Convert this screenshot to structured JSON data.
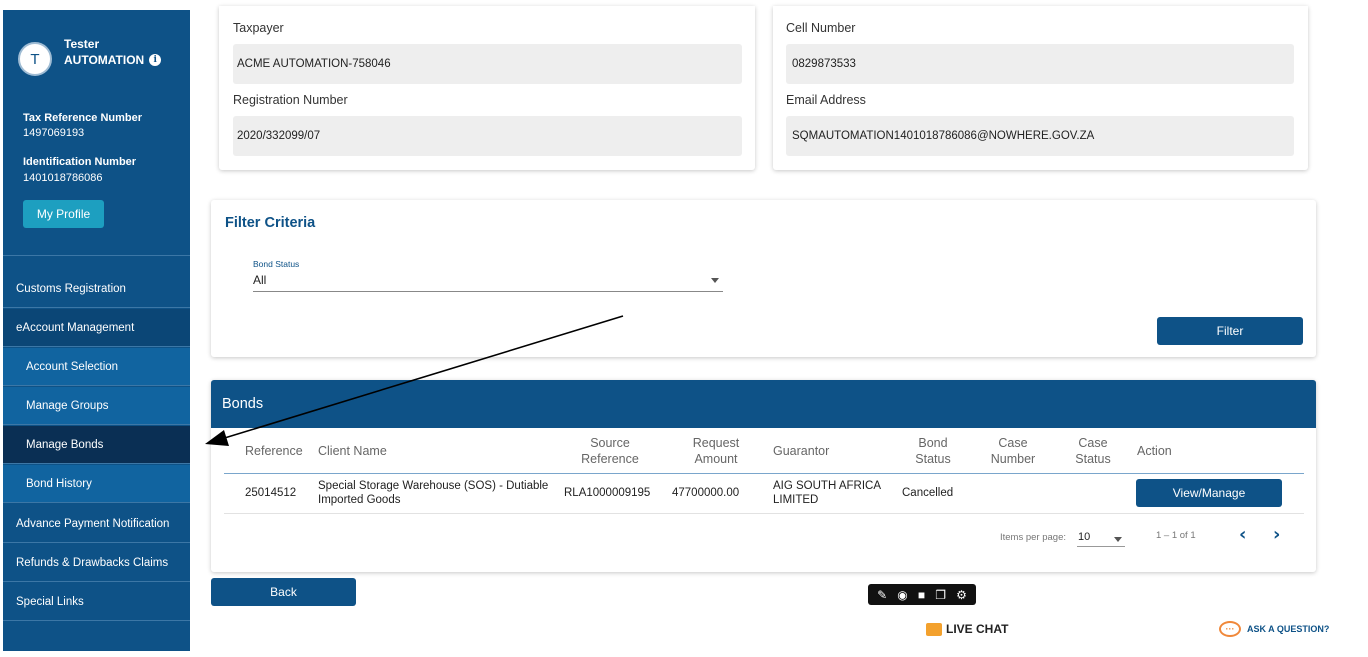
{
  "user": {
    "initial": "T",
    "first_name": "Tester",
    "last_name": "AUTOMATION",
    "tax_ref_label": "Tax Reference Number",
    "tax_ref_value": "1497069193",
    "id_label": "Identification Number",
    "id_value": "1401018786086",
    "profile_button": "My Profile"
  },
  "sidebar": {
    "items": [
      {
        "label": "Customs Registration"
      },
      {
        "label": "eAccount Management"
      },
      {
        "label": "Account Selection"
      },
      {
        "label": "Manage Groups"
      },
      {
        "label": "Manage Bonds"
      },
      {
        "label": "Bond History"
      },
      {
        "label": "Advance Payment Notification"
      },
      {
        "label": "Refunds & Drawbacks Claims"
      },
      {
        "label": "Special Links"
      }
    ],
    "active_item": "Manage Bonds"
  },
  "taxpayer": {
    "taxpayer_label": "Taxpayer",
    "taxpayer_value": "ACME AUTOMATION-758046",
    "registration_label": "Registration Number",
    "registration_value": "2020/332099/07",
    "cell_label": "Cell Number",
    "cell_value": "0829873533",
    "email_label": "Email Address",
    "email_value": "SQMAUTOMATION1401018786086@NOWHERE.GOV.ZA"
  },
  "filter": {
    "title": "Filter Criteria",
    "bond_status_label": "Bond Status",
    "bond_status_value": "All",
    "filter_button": "Filter"
  },
  "bonds": {
    "title": "Bonds",
    "columns": [
      [
        "Reference"
      ],
      [
        "Client Name"
      ],
      [
        "Source",
        "Reference"
      ],
      [
        "Request",
        "Amount"
      ],
      [
        "Guarantor"
      ],
      [
        "Bond",
        "Status"
      ],
      [
        "Case",
        "Number"
      ],
      [
        "Case",
        "Status"
      ],
      [
        "Action"
      ]
    ],
    "rows": [
      {
        "reference": "25014512",
        "client_name_1": "Special Storage Warehouse (SOS) - Dutiable",
        "client_name_2": "Imported Goods",
        "source_reference": "RLA1000009195",
        "request_amount": "47700000.00",
        "guarantor_1": "AIG SOUTH AFRICA",
        "guarantor_2": "LIMITED",
        "bond_status": "Cancelled",
        "case_number": "",
        "case_status": "",
        "action_label": "View/Manage"
      }
    ],
    "pagination": {
      "items_per_page_label": "Items per page:",
      "items_per_page_value": "10",
      "range_text": "1 – 1 of 1"
    }
  },
  "footer": {
    "back_button": "Back",
    "live_chat": "LIVE CHAT",
    "ask_question": "ASK A QUESTION?"
  },
  "colors": {
    "brand": "#0e5287",
    "sidebar_active": "#0a2f54",
    "profile_button": "#1d9fc0",
    "field_bg": "#eeeeee"
  }
}
